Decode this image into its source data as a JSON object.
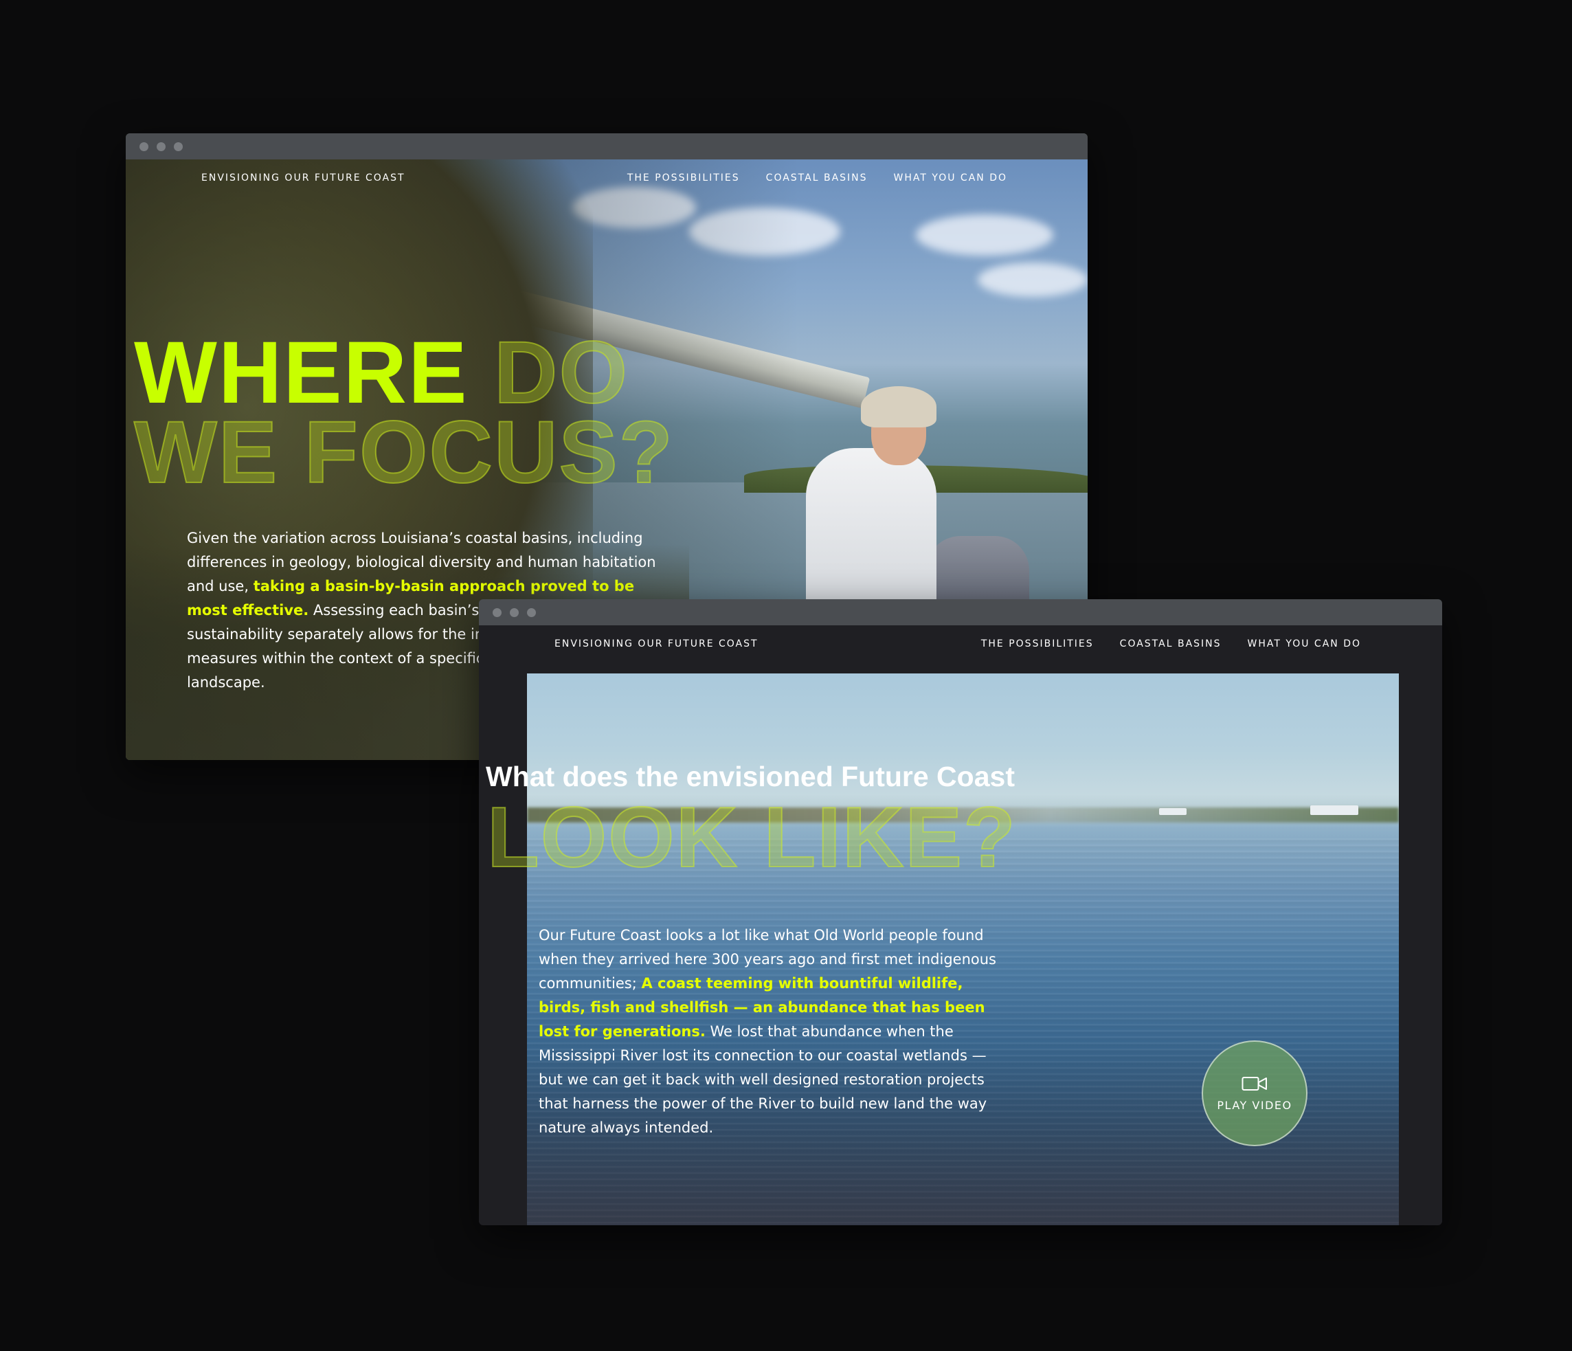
{
  "window1": {
    "nav": {
      "brand": "ENVISIONING OUR FUTURE COAST",
      "links": [
        "THE POSSIBILITIES",
        "COASTAL BASINS",
        "WHAT YOU CAN DO"
      ]
    },
    "headline": {
      "line1_solid": "WHERE",
      "line1_ghost": "DO",
      "line2_ghost": "WE FOCUS?"
    },
    "body": {
      "part1": "Given the variation across Louisiana’s coastal basins, including differences in geology, biological diversity and human habitation and use, ",
      "highlight": "taking a basin-by-basin approach proved to be most effective.",
      "part2": " Assessing each basin’s impact and sustainability separately allows for the integration of m",
      "part3": "measures within the context of a specific",
      "part4": "landscape."
    }
  },
  "window2": {
    "nav": {
      "brand": "ENVISIONING OUR FUTURE COAST",
      "links": [
        "THE POSSIBILITIES",
        "COASTAL BASINS",
        "WHAT YOU CAN DO"
      ]
    },
    "title": "What does the envisioned Future Coast",
    "headline_ghost": "LOOK LIKE?",
    "body": {
      "part1": "Our Future Coast looks a lot like what Old World people found when they arrived here 300 years ago and first met indigenous communities; ",
      "highlight": "A coast teeming with bountiful wildlife, birds, fish and shellfish — an abundance that has been lost for generations.",
      "part2": " We lost that abundance when the Mississippi River lost its connection to our coastal wetlands — but we can get it back with well designed restoration projects that harness the power of the River to build new land the way nature always intended."
    },
    "play_button": {
      "label": "PLAY VIDEO",
      "icon": "video-camera-icon"
    }
  },
  "colors": {
    "accent": "#c8ff00",
    "highlight_text": "#e6ff00",
    "page_background": "#0b0b0c",
    "titlebar": "#4a4d51"
  }
}
